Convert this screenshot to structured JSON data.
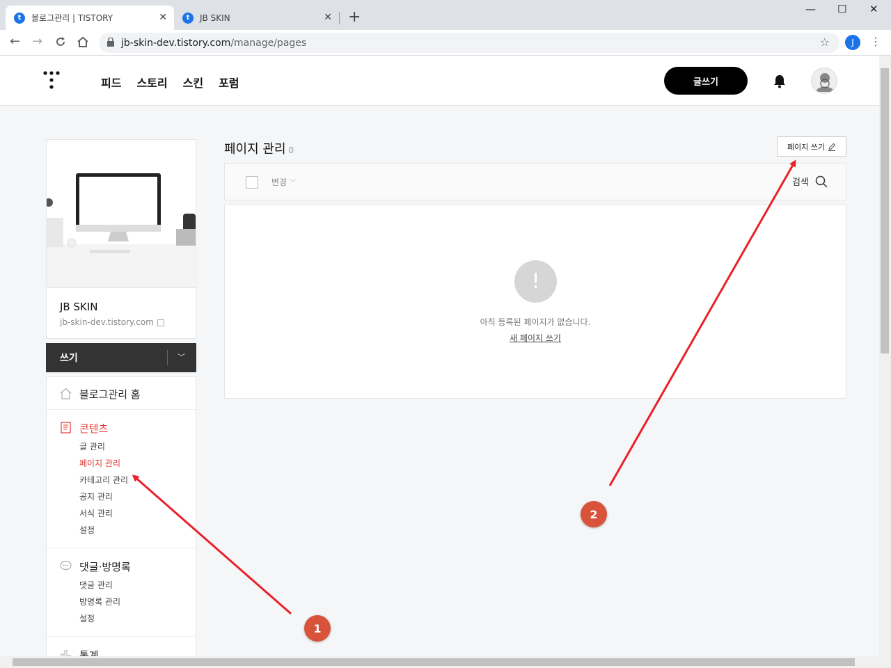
{
  "browser": {
    "tabs": [
      {
        "title": "블로그관리 | TISTORY",
        "close": "✕"
      },
      {
        "title": "JB SKIN",
        "close": "✕"
      }
    ],
    "new_tab": "+",
    "window_controls": {
      "minimize": "—",
      "maximize": "☐",
      "close": "✕"
    },
    "url_host": "jb-skin-dev.tistory.com",
    "url_path": "/manage/pages",
    "profile_initial": "J"
  },
  "header": {
    "nav": [
      "피드",
      "스토리",
      "스킨",
      "포럼"
    ],
    "write_button": "글쓰기"
  },
  "sidebar": {
    "blog_name": "JB SKIN",
    "blog_url": "jb-skin-dev.tistory.com",
    "write_label": "쓰기",
    "home_label": "블로그관리 홈",
    "contents": {
      "label": "콘텐츠",
      "items": [
        "글 관리",
        "페이지 관리",
        "카테고리 관리",
        "공지 관리",
        "서식 관리",
        "설정"
      ]
    },
    "comments": {
      "label": "댓글·방명록",
      "items": [
        "댓글 관리",
        "방명록 관리",
        "설정"
      ]
    },
    "stats_label": "통계"
  },
  "main": {
    "title": "페이지 관리",
    "count": "0",
    "write_page_button": "페이지 쓰기",
    "change_dropdown": "변경",
    "search_label": "검색",
    "empty_message": "아직 등록된 페이지가 없습니다.",
    "empty_link": "새 페이지 쓰기"
  },
  "annotations": {
    "badge1": "1",
    "badge2": "2",
    "arrow_color": "#e8212b",
    "badge_color": "#d9533a"
  },
  "colors": {
    "accent_red": "#e53935",
    "write_button_bg": "#000000",
    "sidebar_write_bg": "#333333"
  }
}
